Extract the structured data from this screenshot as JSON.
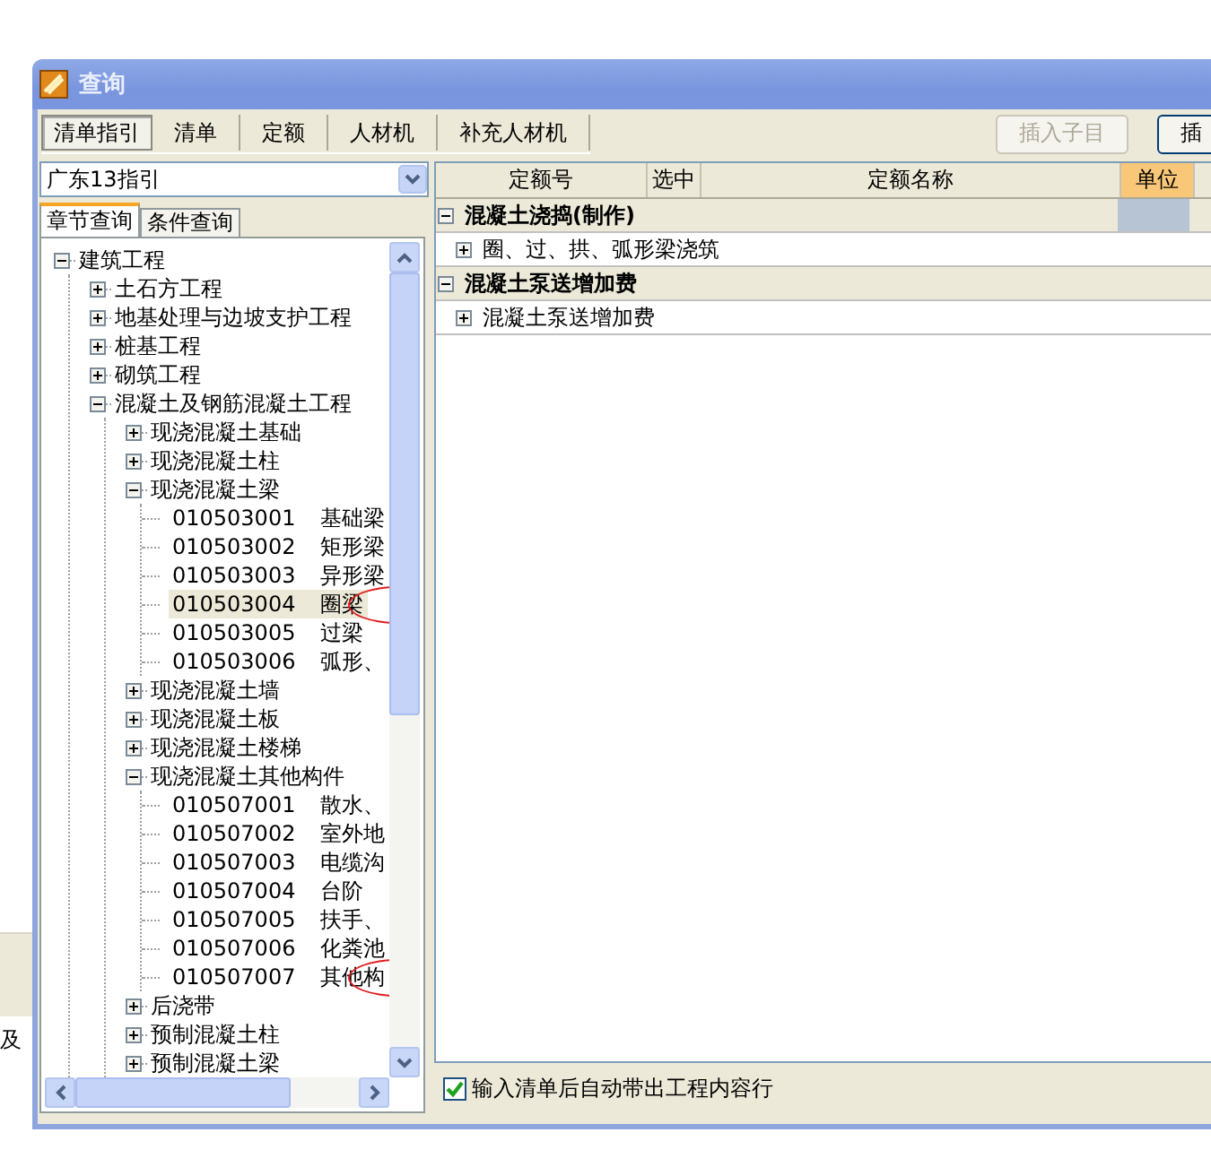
{
  "background_window": {
    "text": "及"
  },
  "window": {
    "title": "查询"
  },
  "tabs": [
    {
      "label": "清单指引",
      "selected": true
    },
    {
      "label": "清单",
      "selected": false
    },
    {
      "label": "定额",
      "selected": false
    },
    {
      "label": "人材机",
      "selected": false
    },
    {
      "label": "补充人材机",
      "selected": false
    }
  ],
  "toolbar_buttons": [
    {
      "label": "插入子目",
      "disabled": true
    },
    {
      "label": "插",
      "disabled": false
    }
  ],
  "library_select": {
    "value": "广东13指引"
  },
  "sub_tabs": [
    {
      "label": "章节查询",
      "selected": true
    },
    {
      "label": "条件查询",
      "selected": false
    }
  ],
  "tree": [
    {
      "label": "建筑工程",
      "expanded": true,
      "children": [
        {
          "label": "土石方工程",
          "expanded": false
        },
        {
          "label": "地基处理与边坡支护工程",
          "expanded": false
        },
        {
          "label": "桩基工程",
          "expanded": false
        },
        {
          "label": "砌筑工程",
          "expanded": false
        },
        {
          "label": "混凝土及钢筋混凝土工程",
          "expanded": true,
          "children": [
            {
              "label": "现浇混凝土基础",
              "expanded": false
            },
            {
              "label": "现浇混凝土柱",
              "expanded": false
            },
            {
              "label": "现浇混凝土梁",
              "expanded": true,
              "children": [
                {
                  "code": "010503001",
                  "label": "基础梁",
                  "selected": false,
                  "circled": false
                },
                {
                  "code": "010503002",
                  "label": "矩形梁",
                  "selected": false,
                  "circled": false
                },
                {
                  "code": "010503003",
                  "label": "异形梁",
                  "selected": false,
                  "circled": false
                },
                {
                  "code": "010503004",
                  "label": "圈梁",
                  "selected": true,
                  "circled": true
                },
                {
                  "code": "010503005",
                  "label": "过梁",
                  "selected": false,
                  "circled": false
                },
                {
                  "code": "010503006",
                  "label": "弧形、",
                  "selected": false,
                  "circled": false
                }
              ]
            },
            {
              "label": "现浇混凝土墙",
              "expanded": false
            },
            {
              "label": "现浇混凝土板",
              "expanded": false
            },
            {
              "label": "现浇混凝土楼梯",
              "expanded": false
            },
            {
              "label": "现浇混凝土其他构件",
              "expanded": true,
              "children": [
                {
                  "code": "010507001",
                  "label": "散水、",
                  "selected": false,
                  "circled": false
                },
                {
                  "code": "010507002",
                  "label": "室外地",
                  "selected": false,
                  "circled": false
                },
                {
                  "code": "010507003",
                  "label": "电缆沟",
                  "selected": false,
                  "circled": false
                },
                {
                  "code": "010507004",
                  "label": "台阶",
                  "selected": false,
                  "circled": false
                },
                {
                  "code": "010507005",
                  "label": "扶手、",
                  "selected": false,
                  "circled": false
                },
                {
                  "code": "010507006",
                  "label": "化粪池",
                  "selected": false,
                  "circled": false
                },
                {
                  "code": "010507007",
                  "label": "其他构",
                  "selected": false,
                  "circled": true
                }
              ]
            },
            {
              "label": "后浇带",
              "expanded": false
            },
            {
              "label": "预制混凝土柱",
              "expanded": false
            },
            {
              "label": "预制混凝土梁",
              "expanded": false
            }
          ]
        }
      ]
    }
  ],
  "grid": {
    "columns": [
      {
        "label": "定额号",
        "selected": false
      },
      {
        "label": "选中",
        "selected": false
      },
      {
        "label": "定额名称",
        "selected": false
      },
      {
        "label": "单位",
        "selected": true
      }
    ],
    "groups": [
      {
        "label": "混凝土浇捣(制作)",
        "expanded": true,
        "unit_cell_selected": true,
        "rows": [
          {
            "label": "圈、过、拱、弧形梁浇筑",
            "expanded": false
          }
        ]
      },
      {
        "label": "混凝土泵送增加费",
        "expanded": true,
        "unit_cell_selected": false,
        "rows": [
          {
            "label": "混凝土泵送增加费",
            "expanded": false
          }
        ]
      }
    ]
  },
  "auto_option": {
    "label": "输入清单后自动带出工程内容行",
    "checked": true
  }
}
